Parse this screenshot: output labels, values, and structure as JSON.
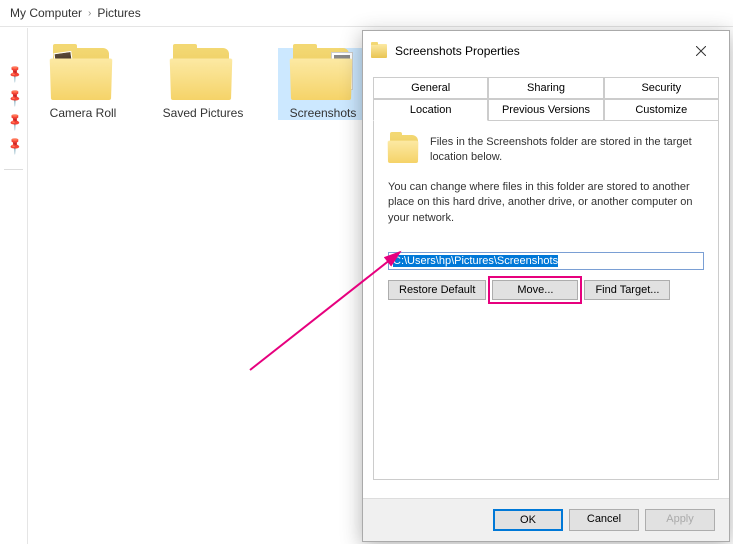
{
  "breadcrumb": {
    "item1": "My Computer",
    "item2": "Pictures"
  },
  "folders": {
    "camera_roll": "Camera Roll",
    "saved_pictures": "Saved Pictures",
    "screenshots": "Screenshots"
  },
  "dialog": {
    "title": "Screenshots Properties",
    "tabs_top": {
      "general": "General",
      "sharing": "Sharing",
      "security": "Security"
    },
    "tabs_bottom": {
      "location": "Location",
      "previous_versions": "Previous Versions",
      "customize": "Customize"
    },
    "location": {
      "info1": "Files in the Screenshots folder are stored in the target location below.",
      "info2": "You can change where files in this folder are stored to another place on this hard drive, another drive, or another computer on your network.",
      "path": "C:\\Users\\hp\\Pictures\\Screenshots",
      "restore": "Restore Default",
      "move": "Move...",
      "find": "Find Target..."
    },
    "footer": {
      "ok": "OK",
      "cancel": "Cancel",
      "apply": "Apply"
    }
  },
  "colors": {
    "annotation": "#e6007e",
    "selection": "#0078d7"
  }
}
